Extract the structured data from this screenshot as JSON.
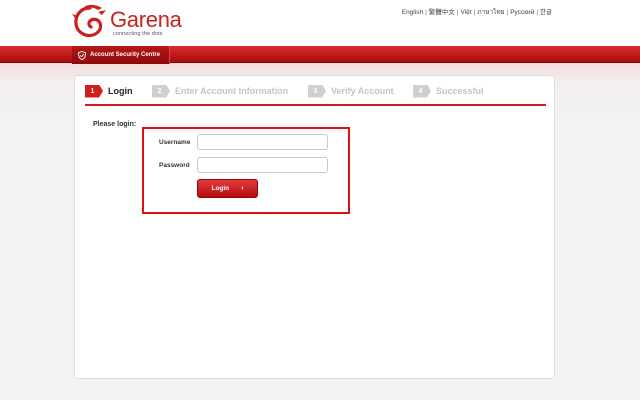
{
  "header": {
    "brand": "Garena",
    "tagline": "connecting the dots",
    "languages": [
      "English",
      "繁體中文",
      "Việt",
      "ภาษาไทย",
      "Русский",
      "한글"
    ]
  },
  "nav": {
    "account_tab": "Account Security Centre"
  },
  "steps": [
    {
      "num": "1",
      "label": "Login",
      "active": true
    },
    {
      "num": "2",
      "label": "Enter Account Information",
      "active": false
    },
    {
      "num": "3",
      "label": "Verify Account",
      "active": false
    },
    {
      "num": "4",
      "label": "Successful",
      "active": false
    }
  ],
  "form": {
    "heading": "Please login:",
    "username_label": "Username",
    "username_value": "",
    "password_label": "Password",
    "password_value": "",
    "submit_label": "Login",
    "submit_arrow": "›"
  },
  "colors": {
    "brand_red": "#d01c1c",
    "highlight": "#e01010"
  }
}
